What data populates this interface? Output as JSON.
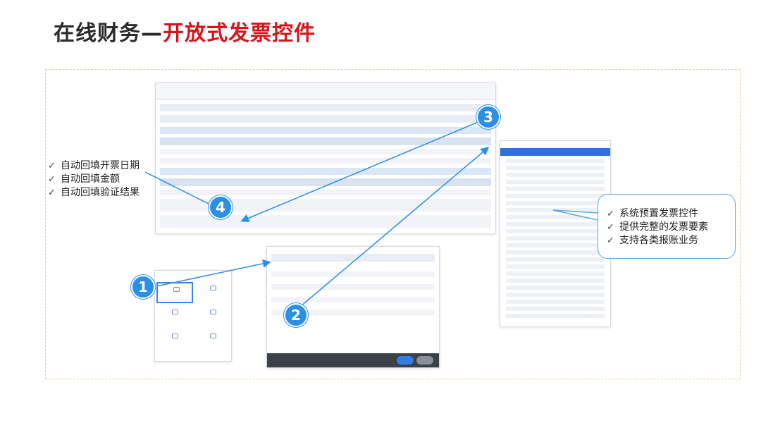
{
  "title": {
    "part1": "在线财务—",
    "part2": "开放式发票控件"
  },
  "left_callout": {
    "items": [
      {
        "label": "自动回填开票日期"
      },
      {
        "label": "自动回填金额"
      },
      {
        "label": "自动回填验证结果"
      }
    ]
  },
  "right_callout": {
    "items": [
      {
        "label": "系统预置发票控件"
      },
      {
        "label": "提供完整的发票要素"
      },
      {
        "label": "支持各类报账业务"
      }
    ]
  },
  "badges": [
    "1",
    "2",
    "3",
    "4"
  ],
  "icons": {
    "check": "✓"
  },
  "colors": {
    "accent_red": "#d6141b",
    "accent_blue": "#2b8fe8",
    "highlight": "#2f6fde"
  }
}
